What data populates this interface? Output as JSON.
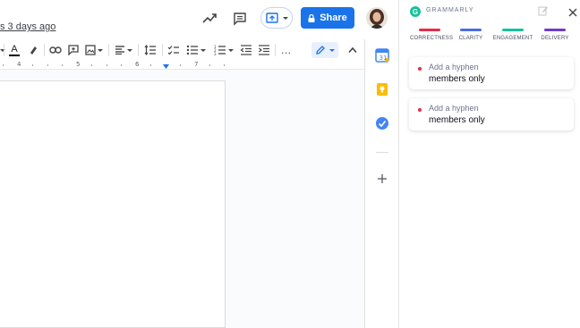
{
  "header": {
    "last_edit": "s 3 days ago",
    "share_label": "Share"
  },
  "ruler": {
    "numbers": [
      "4",
      "5",
      "6",
      "7"
    ]
  },
  "grammarly": {
    "title": "GRAMMARLY",
    "logo_letter": "G",
    "categories": [
      {
        "label": "CORRECTNESS",
        "color": "#e52c4a"
      },
      {
        "label": "CLARITY",
        "color": "#4a6ee0"
      },
      {
        "label": "ENGAGEMENT",
        "color": "#15c39a"
      },
      {
        "label": "DELIVERY",
        "color": "#6c3ccb"
      }
    ],
    "suggestions": [
      {
        "hint": "Add a hyphen",
        "text": "members only"
      },
      {
        "hint": "Add a hyphen",
        "text": "members only"
      }
    ]
  },
  "colors": {
    "accent": "#1a73e8",
    "grammarly_green": "#15c39a",
    "error_red": "#e52c4a"
  }
}
